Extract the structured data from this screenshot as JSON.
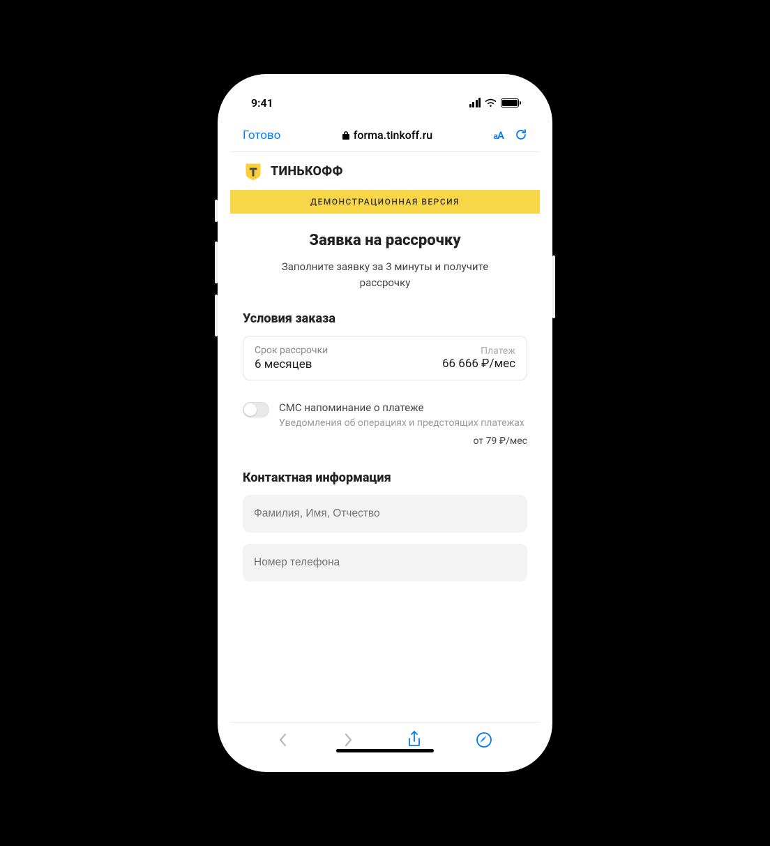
{
  "statusbar": {
    "time": "9:41"
  },
  "addressbar": {
    "done": "Готово",
    "url": "forma.tinkoff.ru",
    "aa": "aA"
  },
  "brand": {
    "name": "ТИНЬКОФФ"
  },
  "demo_banner": "ДЕМОНСТРАЦИОННАЯ ВЕРСИЯ",
  "form": {
    "title": "Заявка на рассрочку",
    "subtitle": "Заполните заявку за 3 минуты и получите рассрочку",
    "terms_header": "Условия заказа",
    "term_label": "Срок рассрочки",
    "term_value": "6 месяцев",
    "payment_label": "Платеж",
    "payment_value": "66 666 ₽/мес",
    "sms_title": "СМС напоминание о платеже",
    "sms_desc": "Уведомления об операциях и предстоящих платежах",
    "sms_price": "от 79 ₽/мес",
    "contact_header": "Контактная информация",
    "fio_placeholder": "Фамилия, Имя, Отчество",
    "phone_placeholder": "Номер телефона"
  }
}
